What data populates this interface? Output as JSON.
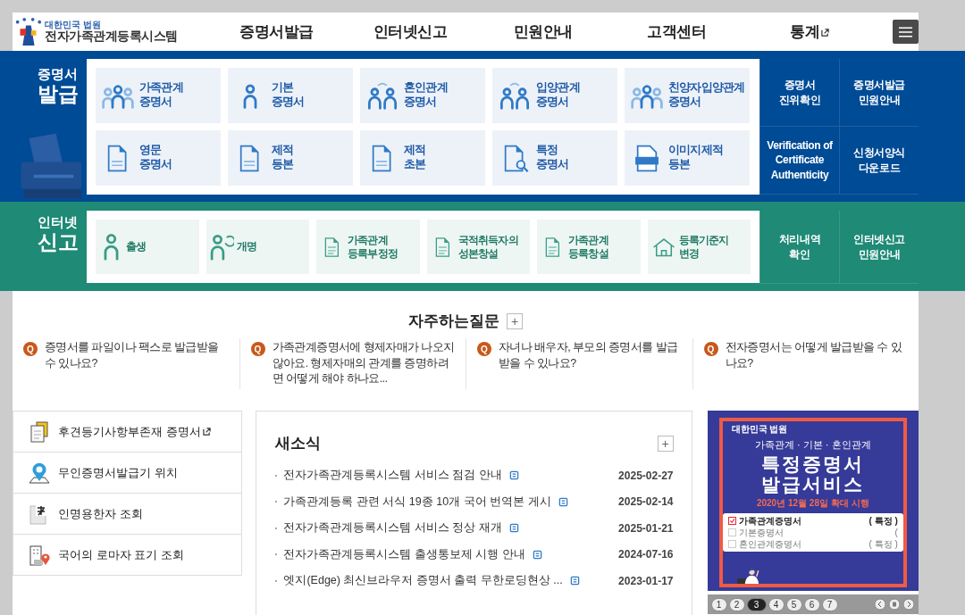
{
  "header": {
    "org": "대한민국 법원",
    "title": "전자가족관계등록시스템",
    "nav": [
      {
        "label": "증명서발급",
        "external": false
      },
      {
        "label": "인터넷신고",
        "external": false
      },
      {
        "label": "민원안내",
        "external": false
      },
      {
        "label": "고객센터",
        "external": false
      },
      {
        "label": "통계",
        "external": true
      }
    ]
  },
  "certificate": {
    "heading": [
      "증명서",
      "발급"
    ],
    "tiles": [
      {
        "lines": [
          "가족관계",
          "증명서"
        ]
      },
      {
        "lines": [
          "기본",
          "증명서"
        ]
      },
      {
        "lines": [
          "혼인관계",
          "증명서"
        ]
      },
      {
        "lines": [
          "입양관계",
          "증명서"
        ]
      },
      {
        "lines": [
          "친양자입양관계",
          "증명서"
        ]
      },
      {
        "lines": [
          "영문",
          "증명서"
        ]
      },
      {
        "lines": [
          "제적",
          "등본"
        ]
      },
      {
        "lines": [
          "제적",
          "초본"
        ]
      },
      {
        "lines": [
          "특정",
          "증명서"
        ]
      },
      {
        "lines": [
          "이미지제적",
          "등본"
        ]
      }
    ],
    "links": [
      {
        "lines": [
          "증명서",
          "진위확인"
        ]
      },
      {
        "lines": [
          "증명서발급",
          "민원안내"
        ]
      },
      {
        "lines": [
          "Verification of",
          "Certificate",
          "Authenticity"
        ]
      },
      {
        "lines": [
          "신청서양식",
          "다운로드"
        ]
      }
    ]
  },
  "report": {
    "heading": [
      "인터넷",
      "신고"
    ],
    "tiles": [
      {
        "lines": [
          "출생"
        ]
      },
      {
        "lines": [
          "개명"
        ]
      },
      {
        "lines": [
          "가족관계",
          "등록부정정"
        ]
      },
      {
        "lines": [
          "국적취득자의",
          "성본창설"
        ]
      },
      {
        "lines": [
          "가족관계",
          "등록창설"
        ]
      },
      {
        "lines": [
          "등록기준지",
          "변경"
        ]
      }
    ],
    "links": [
      {
        "lines": [
          "처리내역",
          "확인"
        ]
      },
      {
        "lines": [
          "인터넷신고",
          "민원안내"
        ]
      }
    ]
  },
  "faq": {
    "title": "자주하는질문",
    "more": "+",
    "items": [
      {
        "marker": "Q",
        "text": "증명서를 파일이나 팩스로 발급받을 수 있나요?"
      },
      {
        "marker": "Q",
        "text": "가족관계증명서에 형제자매가 나오지 않아요. 형제자매의 관계를 증명하려면 어떻게 해야 하나요..."
      },
      {
        "marker": "Q",
        "text": "자녀나 배우자, 부모의 증명서를 발급 받을 수 있나요?"
      },
      {
        "marker": "Q",
        "text": "전자증명서는 어떻게 발급받을 수 있나요?"
      }
    ]
  },
  "quick_links": [
    {
      "label": "후견등기사항부존재 증명서",
      "external": true
    },
    {
      "label": "무인증명서발급기 위치",
      "external": false
    },
    {
      "label": "인명용한자 조회",
      "external": false
    },
    {
      "label": "국어의 로마자 표기 조회",
      "external": false
    }
  ],
  "news": {
    "title": "새소식",
    "more": "+",
    "items": [
      {
        "title": "전자가족관계등록시스템 서비스 점검 안내",
        "date": "2025-02-27"
      },
      {
        "title": "가족관계등록 관련 서식 19종 10개 국어 번역본 게시",
        "date": "2025-02-14"
      },
      {
        "title": "전자가족관계등록시스템 서비스 정상 재개",
        "date": "2025-01-21"
      },
      {
        "title": "전자가족관계등록시스템 출생통보제 시행 안내",
        "date": "2024-07-16"
      },
      {
        "title": "엣지(Edge) 최신브라우저 증명서 출력 무한로딩현상 ...",
        "date": "2023-01-17"
      }
    ]
  },
  "banner": {
    "org": "대한민국 법원",
    "subtitle": "가족관계 · 기본 · 혼인관계",
    "title": [
      "특정증명서",
      "발급서비스"
    ],
    "date": "2020년 12월 28일 확대 시행",
    "options": [
      {
        "label": "가족관계증명서",
        "tag": "( 특정 )",
        "checked": true
      },
      {
        "label": "기본증명서",
        "tag": "(",
        "checked": false
      },
      {
        "label": "혼인관계증명서",
        "tag": "( 특정 )",
        "checked": false
      }
    ],
    "pages": [
      {
        "label": "1",
        "selected": false
      },
      {
        "label": "2",
        "selected": false
      },
      {
        "label": "3",
        "selected": true
      },
      {
        "label": "4",
        "selected": false
      },
      {
        "label": "5",
        "selected": false
      },
      {
        "label": "6",
        "selected": false
      },
      {
        "label": "7",
        "selected": false
      }
    ]
  }
}
